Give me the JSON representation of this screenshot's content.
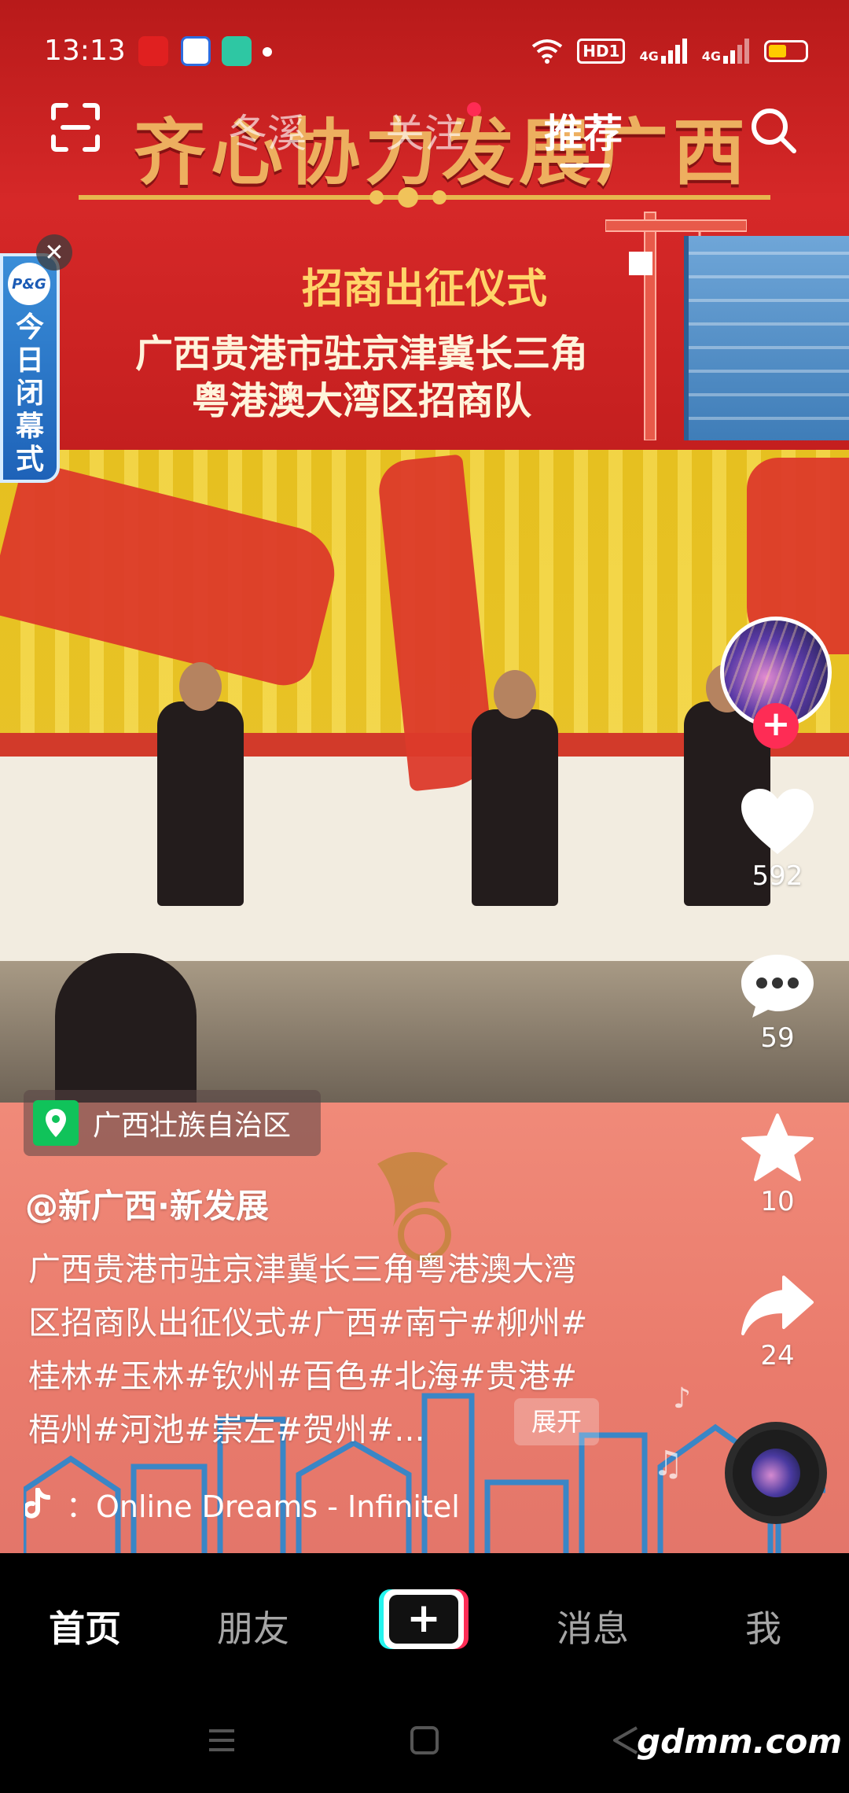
{
  "status_bar": {
    "time": "13:13",
    "hd_label": "HD1",
    "sim1_label": "4G",
    "sim2_label": "4G",
    "battery_level": 0.5
  },
  "top_nav": {
    "tabs": [
      {
        "label": "冬溪",
        "active": false
      },
      {
        "label": "关注",
        "active": false
      },
      {
        "label": "推荐",
        "active": true
      }
    ]
  },
  "video": {
    "banner_title": "齐心协力发展广西",
    "banner_subtitle": "招商出征仪式",
    "banner_line1": "广西贵港市驻京津冀长三角",
    "banner_line2": "粤港澳大湾区招商队"
  },
  "ad": {
    "brand": "P&G",
    "text": "今日闭幕式"
  },
  "actions": {
    "like_count": "592",
    "comment_count": "59",
    "favorite_count": "10",
    "share_count": "24"
  },
  "info": {
    "location": "广西壮族自治区",
    "author": "@新广西·新发展",
    "caption": "广西贵港市驻京津冀长三角粤港澳大湾区招商队出征仪式#广西#南宁#柳州#桂林#玉林#钦州#百色#北海#贵港#梧州#河池#崇左#贺州#...",
    "expand_label": "展开",
    "music": "：Online Dreams - Infinitel"
  },
  "bottom_nav": {
    "items": [
      {
        "label": "首页",
        "active": true
      },
      {
        "label": "朋友",
        "active": false
      },
      {
        "label": "+",
        "active": false
      },
      {
        "label": "消息",
        "active": false
      },
      {
        "label": "我",
        "active": false
      }
    ]
  },
  "watermark": "gdmm.com",
  "colors": {
    "accent_red": "#fe2c55",
    "accent_cyan": "#25f4ee",
    "location_green": "#10c35a"
  }
}
